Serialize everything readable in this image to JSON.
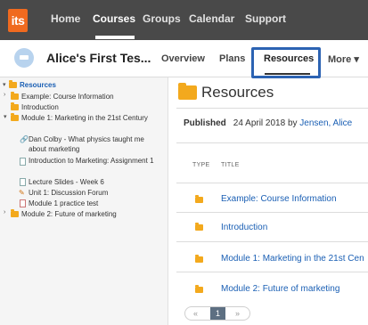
{
  "nav": {
    "logo_text": "its",
    "items": [
      {
        "label": "Home"
      },
      {
        "label": "Courses"
      },
      {
        "label": "Groups"
      },
      {
        "label": "Calendar"
      },
      {
        "label": "Support"
      }
    ],
    "active_item": "Courses"
  },
  "course": {
    "title": "Alice's First Tes...",
    "tabs": [
      {
        "label": "Overview"
      },
      {
        "label": "Plans"
      },
      {
        "label": "Resources"
      },
      {
        "label": "More ▾"
      }
    ],
    "active_tab": "Resources"
  },
  "sidebar": {
    "root": "Resources",
    "items": [
      {
        "label": "Example: Course Information",
        "icon": "folder-icon"
      },
      {
        "label": "Introduction",
        "icon": "folder-icon"
      },
      {
        "label": "Module 1: Marketing in the 21st Century",
        "icon": "folder-icon"
      },
      {
        "label": "Dan Colby - What physics taught me about marketing",
        "icon": "link-icon"
      },
      {
        "label": "Introduction to Marketing: Assignment 1",
        "icon": "assignment-icon"
      },
      {
        "label": "Lecture Slides - Week 6",
        "icon": "document-icon"
      },
      {
        "label": "Unit 1: Discussion Forum",
        "icon": "forum-icon"
      },
      {
        "label": "Module 1 practice test",
        "icon": "quiz-icon"
      },
      {
        "label": "Module 2: Future of marketing",
        "icon": "folder-icon"
      }
    ]
  },
  "main": {
    "title": "Resources",
    "published_label": "Published",
    "published_date": "24 April 2018 by",
    "published_author": "Jensen, Alice",
    "columns": {
      "type": "TYPE",
      "title": "TITLE"
    },
    "rows": [
      {
        "title": "Example: Course Information",
        "icon": "folder-icon"
      },
      {
        "title": "Introduction",
        "icon": "folder-icon"
      },
      {
        "title": "Module 1: Marketing in the 21st Cen",
        "icon": "folder-icon"
      },
      {
        "title": "Module 2: Future of marketing",
        "icon": "folder-icon"
      }
    ],
    "pager": {
      "prev": "«",
      "current": "1",
      "next": "»"
    }
  },
  "colors": {
    "nav_bg": "#494949",
    "logo": "#f06a1f",
    "link": "#1a5fb4",
    "folder": "#f3a91d",
    "highlight": "#2c63b3"
  }
}
